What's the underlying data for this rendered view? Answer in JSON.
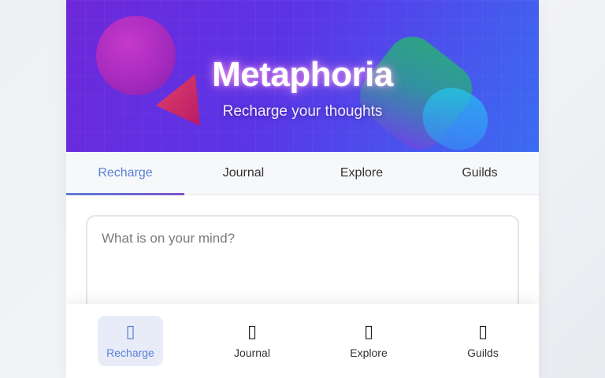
{
  "header": {
    "title": "Metaphoria",
    "subtitle": "Recharge your thoughts"
  },
  "tabs": [
    {
      "label": "Recharge",
      "active": true
    },
    {
      "label": "Journal",
      "active": false
    },
    {
      "label": "Explore",
      "active": false
    },
    {
      "label": "Guilds",
      "active": false
    }
  ],
  "composer": {
    "placeholder": "What is on your mind?",
    "value": ""
  },
  "bottom_nav": [
    {
      "label": "Recharge",
      "icon": "recharge-icon",
      "glyph": "▯",
      "active": true
    },
    {
      "label": "Journal",
      "icon": "journal-icon",
      "glyph": "▯",
      "active": false
    },
    {
      "label": "Explore",
      "icon": "explore-icon",
      "glyph": "▯",
      "active": false
    },
    {
      "label": "Guilds",
      "icon": "guilds-icon",
      "glyph": "▯",
      "active": false
    }
  ],
  "colors": {
    "accent": "#5b7fd6",
    "hero_start": "#6d28d9",
    "hero_end": "#3b6cf2"
  }
}
